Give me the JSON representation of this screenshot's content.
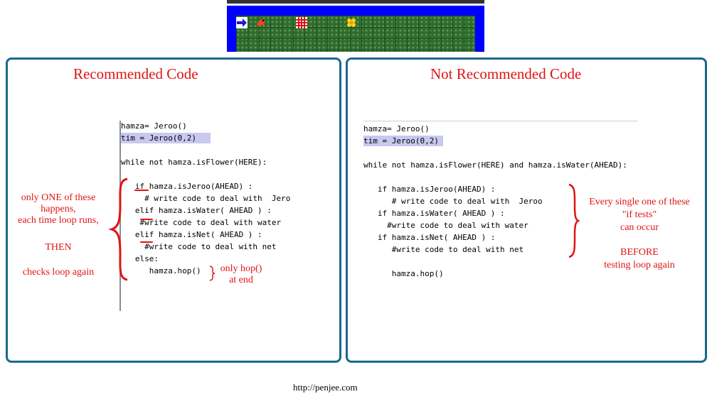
{
  "left_panel": {
    "title": "Recommended Code",
    "code_lines": [
      "hamza= Jeroo()",
      "tim = Jeroo(0,2)",
      "",
      "while not hamza.isFlower(HERE):",
      "",
      "   if hamza.isJeroo(AHEAD) :",
      "     # write code to deal with  Jero",
      "   elif hamza.isWater( AHEAD ) :",
      "    #write code to deal with water",
      "   elif hamza.isNet( AHEAD ) :",
      "     #write code to deal with net",
      "   else:",
      "      hamza.hop()"
    ],
    "annotation_left": [
      "only  ONE of these",
      "happens,",
      "each time loop runs,",
      "THEN",
      "checks loop again"
    ],
    "annotation_hop": [
      "only hop()",
      "at end"
    ]
  },
  "right_panel": {
    "title": "Not Recommended Code",
    "code_lines": [
      "hamza= Jeroo()",
      "tim = Jeroo(0,2)",
      "",
      "while not hamza.isFlower(HERE) and hamza.isWater(AHEAD):",
      "",
      "   if hamza.isJeroo(AHEAD) :",
      "      # write code to deal with  Jeroo",
      "   if hamza.isWater( AHEAD ) :",
      "     #write code to deal with water",
      "   if hamza.isNet( AHEAD ) :",
      "      #write code to deal with net",
      "",
      "      hamza.hop()"
    ],
    "annotation_right": [
      "Every single one of these",
      "\"if tests\"",
      "can occur",
      "",
      "BEFORE",
      "testing loop again"
    ]
  },
  "footer": "http://penjee.com",
  "colors": {
    "accent_red": "#e01414",
    "panel_border": "#1b6a8a",
    "highlight": "#c8c8f0",
    "game_bg": "#0000ff",
    "grass": "#2f6b2f"
  },
  "icons": [
    "arrow-icon",
    "jeroo-icon",
    "net-icon",
    "flower-icon"
  ]
}
